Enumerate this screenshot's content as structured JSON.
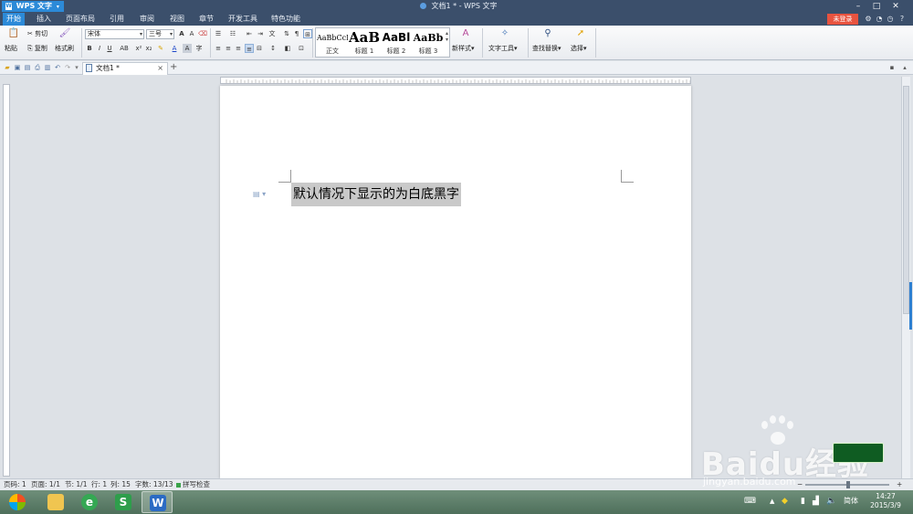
{
  "titlebar": {
    "app_button": "WPS 文字",
    "doc_title": "文档1 * - WPS 文字",
    "window_controls": [
      "minimize-icon",
      "maximize-icon",
      "close-icon"
    ]
  },
  "menubar": {
    "items": [
      "开始",
      "插入",
      "页面布局",
      "引用",
      "审阅",
      "视图",
      "章节",
      "开发工具",
      "特色功能"
    ],
    "active": "开始",
    "login": "未登录"
  },
  "ribbon": {
    "paste": "粘贴",
    "cut": "剪切",
    "copy": "复制",
    "format_painter": "格式刷",
    "font_name": "宋体",
    "font_size": "三号",
    "styles": [
      {
        "preview": "AaBbCcDd",
        "label": "正文"
      },
      {
        "preview": "AaB",
        "label": "标题 1"
      },
      {
        "preview": "AaBl",
        "label": "标题 2"
      },
      {
        "preview": "AaBb",
        "label": "标题 3"
      }
    ],
    "new_style": "新样式",
    "text_tools": "文字工具",
    "find_replace": "查找替换",
    "select": "选择"
  },
  "tabs": {
    "doc_tab": "文档1 *",
    "new_tab": "+"
  },
  "document": {
    "content": "默认情况下显示的为白底黑字"
  },
  "statusbar": {
    "page_num": "页码: 1",
    "pages": "页面: 1/1",
    "section": "节: 1/1",
    "line": "行: 1",
    "column": "列: 15",
    "word_count": "字数: 13/13",
    "spell_check": "拼写检查",
    "zoom_minus": "−",
    "zoom_plus": "+"
  },
  "taskbar": {
    "time": "14:27",
    "date": "2015/3/9",
    "ime": "简体"
  },
  "watermark": {
    "brand": "Baidu经验",
    "url": "jingyan.baidu.com"
  },
  "colors": {
    "title_bg": "#3b4f6b",
    "accent": "#2c8ad8",
    "login_red": "#e8533f",
    "selection": "#c9c9c9"
  }
}
